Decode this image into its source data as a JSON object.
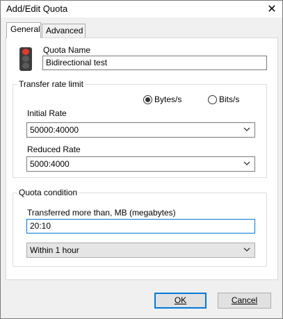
{
  "window": {
    "title": "Add/Edit Quota",
    "close_glyph": "✕"
  },
  "tabs": [
    {
      "label": "General",
      "active": true
    },
    {
      "label": "Advanced",
      "active": false
    }
  ],
  "quota": {
    "icon": "traffic-light-icon",
    "name_label": "Quota Name",
    "name_value": "Bidirectional test"
  },
  "transfer": {
    "legend": "Transfer rate limit",
    "radio_bytes": "Bytes/s",
    "radio_bits": "Bits/s",
    "selected_unit": "Bytes/s",
    "initial_label": "Initial Rate",
    "initial_value": "50000:40000",
    "reduced_label": "Reduced Rate",
    "reduced_value": "5000:4000"
  },
  "condition": {
    "legend": "Quota condition",
    "transferred_label": "Transferred more than, MB (megabytes)",
    "transferred_value": "20:10",
    "period_value": "Within 1 hour"
  },
  "buttons": {
    "ok": "OK",
    "cancel": "Cancel"
  }
}
